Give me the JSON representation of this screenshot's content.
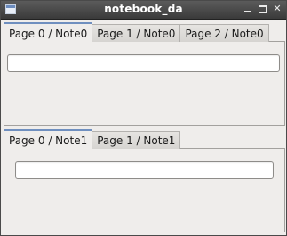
{
  "window": {
    "title": "notebook_da",
    "icon": "app-window-icon",
    "controls": [
      "minimize-icon",
      "maximize-icon",
      "close-icon"
    ],
    "close_glyph": "✕"
  },
  "notebook1": {
    "tabs": [
      {
        "label": "Page 0 / Note0",
        "active": true
      },
      {
        "label": "Page 1 / Note0",
        "active": false
      },
      {
        "label": "Page 2 / Note0",
        "active": false
      }
    ],
    "entry": {
      "value": ""
    }
  },
  "notebook2": {
    "tabs": [
      {
        "label": "Page 0 / Note1",
        "active": true
      },
      {
        "label": "Page 1 / Note1",
        "active": false
      }
    ],
    "entry": {
      "value": ""
    }
  },
  "colors": {
    "titlebar": "#4a4a4a",
    "window_bg": "#efedeb",
    "active_tab_highlight": "#6f8fbf"
  }
}
